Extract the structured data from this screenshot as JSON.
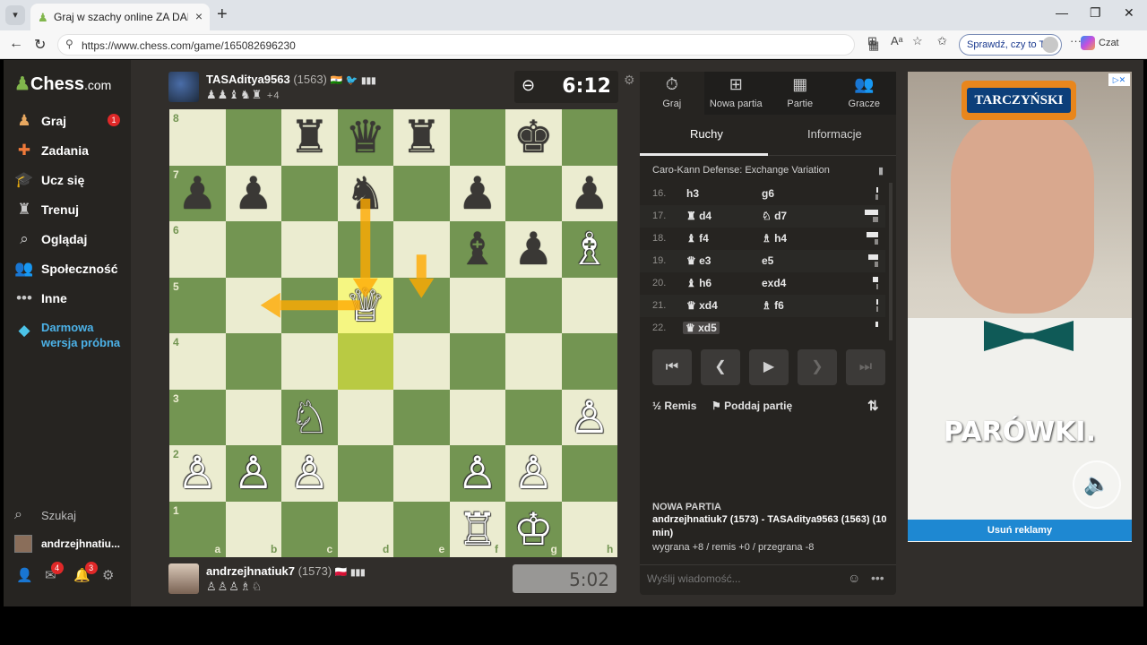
{
  "browser": {
    "tab_title": "Graj w szachy online ZA DARMO - C",
    "url": "https://www.chess.com/game/165082696230",
    "sprawdz_label": "Sprawdź, czy to Ty",
    "czat_label": "Czat"
  },
  "sidebar": {
    "logo_main": "Chess",
    "logo_suffix": ".com",
    "items": [
      {
        "label": "Graj",
        "icon": "play-icon",
        "badge": "1"
      },
      {
        "label": "Zadania",
        "icon": "puzzle-icon"
      },
      {
        "label": "Ucz się",
        "icon": "learn-icon"
      },
      {
        "label": "Trenuj",
        "icon": "train-icon"
      },
      {
        "label": "Oglądaj",
        "icon": "watch-icon"
      },
      {
        "label": "Społeczność",
        "icon": "community-icon"
      },
      {
        "label": "Inne",
        "icon": "more-icon"
      }
    ],
    "trial_label": "Darmowa wersja próbna",
    "search_label": "Szukaj",
    "username": "andrzejhnatiu...",
    "bottom": {
      "friends_badge": "",
      "mail_badge": "4",
      "notif_badge": "3"
    }
  },
  "top_player": {
    "name": "TASAditya9563",
    "rating": "(1563)",
    "captured": "♟♟♝♞♜",
    "advantage": "+4",
    "clock": "6:12"
  },
  "bottom_player": {
    "name": "andrzejhnatiuk7",
    "rating": "(1573)",
    "captured": "♙♙♙♗♘",
    "clock": "5:02"
  },
  "board": {
    "files": [
      "a",
      "b",
      "c",
      "d",
      "e",
      "f",
      "g",
      "h"
    ],
    "ranks": [
      "8",
      "7",
      "6",
      "5",
      "4",
      "3",
      "2",
      "1"
    ],
    "highlight": [
      "d5",
      "d4"
    ],
    "pieces": {
      "c8": "♜",
      "d8": "♛",
      "e8": "♜",
      "g8": "♚",
      "a7": "♟",
      "b7": "♟",
      "d7": "♞",
      "f7": "♟",
      "h7": "♟",
      "f6": "♝",
      "g6": "♟",
      "h6": "♗",
      "d5": "♕",
      "c3": "♘",
      "h3": "♙",
      "a2": "♙",
      "b2": "♙",
      "c2": "♙",
      "f2": "♙",
      "g2": "♙",
      "f1": "♖",
      "g1": "♔"
    },
    "white_squares": [
      "h6",
      "d5",
      "c3",
      "h3",
      "a2",
      "b2",
      "c2",
      "f2",
      "g2",
      "f1",
      "g1"
    ],
    "arrows": [
      {
        "from": "d7",
        "to": "d5"
      },
      {
        "from": "d5",
        "to": "b5"
      },
      {
        "from": "e6",
        "to": "e5"
      }
    ]
  },
  "right_panel": {
    "tabs": [
      {
        "label": "Graj",
        "icon": "stopwatch-icon"
      },
      {
        "label": "Nowa partia",
        "icon": "plus-icon"
      },
      {
        "label": "Partie",
        "icon": "board-icon"
      },
      {
        "label": "Gracze",
        "icon": "players-icon"
      }
    ],
    "subtabs": [
      "Ruchy",
      "Informacje"
    ],
    "opening": "Caro-Kann Defense: Exchange Variation",
    "moves": [
      {
        "num": "16.",
        "white": "h3",
        "black": "g6",
        "wt": 0.04,
        "bt": 0.1
      },
      {
        "num": "17.",
        "white": "♜ d4",
        "black": "♘ d7",
        "wt": 0.55,
        "bt": 0.2
      },
      {
        "num": "18.",
        "white": "♝ f4",
        "black": "♗ h4",
        "wt": 0.45,
        "bt": 0.15
      },
      {
        "num": "19.",
        "white": "♛ e3",
        "black": "e5",
        "wt": 0.4,
        "bt": 0.15
      },
      {
        "num": "20.",
        "white": "♝ h6",
        "black": "exd4",
        "wt": 0.2,
        "bt": 0.08
      },
      {
        "num": "21.",
        "white": "♛ xd4",
        "black": "♗ f6",
        "wt": 0.05,
        "bt": 0.03
      },
      {
        "num": "22.",
        "white": "♛ xd5",
        "black": "",
        "wt": 0.12,
        "bt": 0
      }
    ],
    "controls": [
      "first-icon",
      "prev-icon",
      "play-icon",
      "next-icon",
      "last-icon"
    ],
    "draw_label": "Remis",
    "draw_icon": "½",
    "resign_label": "Poddaj partię",
    "new_game": {
      "title": "NOWA PARTIA",
      "players": "andrzejhnatiuk7 (1573) - TASAditya9563 (1563) (10 min)",
      "stats": "wygrana +8 / remis +0 / przegrana -8"
    },
    "chat_placeholder": "Wyślij wiadomość..."
  },
  "ad": {
    "brand": "TARCZYŃSKI",
    "slogan": "PARÓWKI.",
    "remove_label": "Usuń reklamy"
  }
}
